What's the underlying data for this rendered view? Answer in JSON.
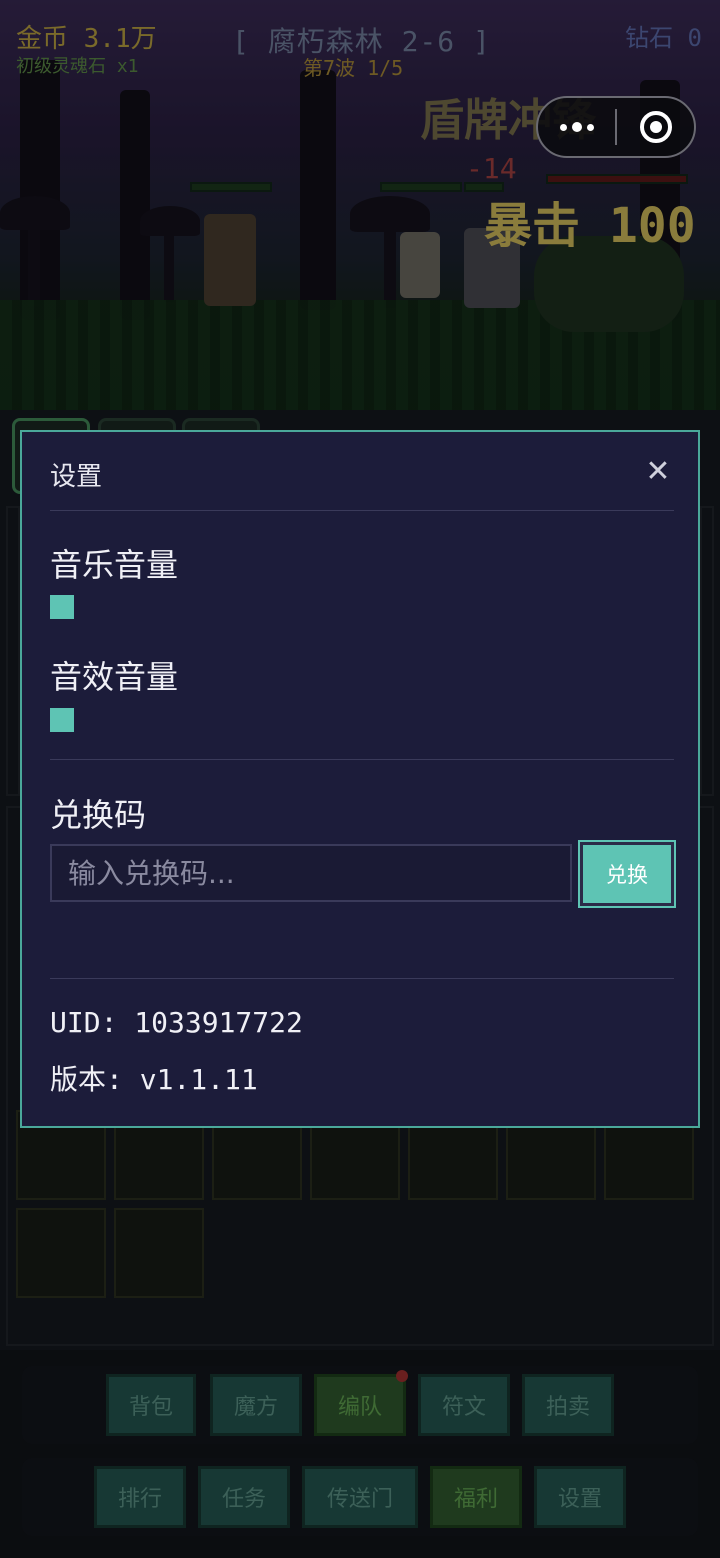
{
  "hud": {
    "gold": "金币 3.1万",
    "soul_stone": "初级灵魂石 x1",
    "stage": "[ 腐朽森林 2-6 ]",
    "wave": "第7波 1/5",
    "diamond": "钻石 0"
  },
  "battle": {
    "skill_text": "盾牌冲锋",
    "damage_text": "-14",
    "crit_text": "暴击 100"
  },
  "capsule": {
    "more_icon": "more-dots-icon",
    "close_icon": "target-circle-icon"
  },
  "settings_modal": {
    "title": "设置",
    "close_symbol": "✕",
    "music_label": "音乐音量",
    "sfx_label": "音效音量",
    "redeem_label": "兑换码",
    "redeem_placeholder": "输入兑换码...",
    "redeem_button": "兑换",
    "uid_text": "UID: 1033917722",
    "version_text": "版本: v1.1.11",
    "accent_color": "#5ec4b4",
    "background_color": "#1c1c3a"
  },
  "bottom_nav": {
    "row1": [
      "背包",
      "魔方",
      "编队",
      "符文",
      "拍卖"
    ],
    "row2": [
      "排行",
      "任务",
      "传送门",
      "福利",
      "设置"
    ]
  }
}
